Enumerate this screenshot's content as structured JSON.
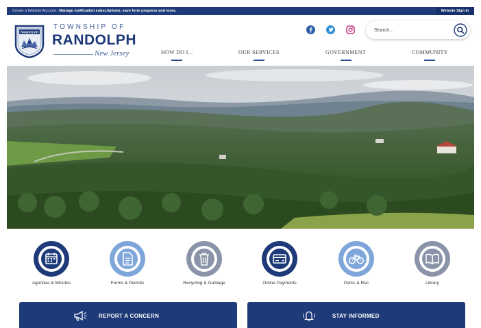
{
  "topbar": {
    "message_lead": "Create a Website Account",
    "message_rest": " - Manage notification subscriptions, save form progress and more.",
    "signin_label": "Website Sign In"
  },
  "logo": {
    "badge_text": "RANDOLPH",
    "township": "TOWNSHIP OF",
    "name": "RANDOLPH",
    "state": "New Jersey"
  },
  "nav": {
    "items": [
      {
        "label": "HOW DO I..."
      },
      {
        "label": "OUR SERVICES"
      },
      {
        "label": "GOVERNMENT"
      },
      {
        "label": "COMMUNITY"
      }
    ]
  },
  "social": [
    {
      "icon": "facebook-icon",
      "color": "#2d5fa8"
    },
    {
      "icon": "twitter-icon",
      "color": "#2d8fd6"
    },
    {
      "icon": "instagram-icon",
      "color": "#c13584"
    }
  ],
  "search": {
    "placeholder": "Search..."
  },
  "quick_links": [
    {
      "label": "Agendas & Minutes",
      "icon": "calendar-icon",
      "ring_color": "#1e3a78"
    },
    {
      "label": "Forms & Permits",
      "icon": "document-icon",
      "ring_color": "#7fa6db"
    },
    {
      "label": "Recycling & Garbage",
      "icon": "trash-icon",
      "ring_color": "#8a93a8"
    },
    {
      "label": "Online Payments",
      "icon": "credit-card-icon",
      "ring_color": "#1e3a78"
    },
    {
      "label": "Parks & Rec",
      "icon": "bicycle-icon",
      "ring_color": "#7fa6db"
    },
    {
      "label": "Library",
      "icon": "book-icon",
      "ring_color": "#8a93a8"
    }
  ],
  "cta": {
    "report_label": "REPORT A CONCERN",
    "inform_label": "STAY INFORMED"
  },
  "colors": {
    "brand_navy": "#1e3a78",
    "accent_light_blue": "#7fa6db",
    "accent_gray": "#8a93a8"
  }
}
